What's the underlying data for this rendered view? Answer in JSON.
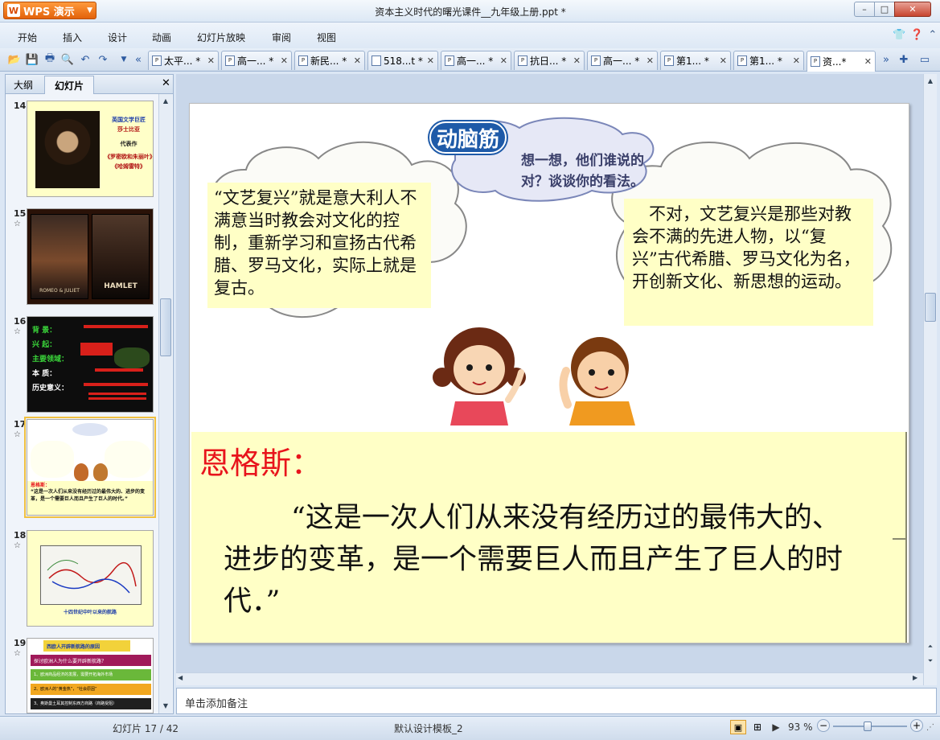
{
  "window": {
    "app_name": "WPS 演示",
    "title": "资本主义时代的曙光课件__九年级上册.ppt *",
    "min_label": "–",
    "max_label": "□",
    "close_label": "✕"
  },
  "menu": [
    "开始",
    "插入",
    "设计",
    "动画",
    "幻灯片放映",
    "审阅",
    "视图"
  ],
  "tabs": [
    {
      "label": "太平... *",
      "close": "✕"
    },
    {
      "label": "高一... *",
      "close": "✕"
    },
    {
      "label": "新民... *",
      "close": "✕"
    },
    {
      "label": "518...t *",
      "close": "✕"
    },
    {
      "label": "高一... *",
      "close": "✕"
    },
    {
      "label": "抗日... *",
      "close": "✕"
    },
    {
      "label": "高一... *",
      "close": "✕"
    },
    {
      "label": "第1... *",
      "close": "✕"
    },
    {
      "label": "第1... *",
      "close": "✕"
    },
    {
      "label": "资...*",
      "close": "✕"
    }
  ],
  "panel": {
    "tab_outline": "大纲",
    "tab_slides": "幻灯片",
    "close": "✕",
    "thumbnails": [
      {
        "num": "14",
        "star": "",
        "lines": [
          "英国文学巨匠",
          "莎士比亚",
          "代表作",
          "《罗密欧和朱丽叶》",
          "《哈姆雷特》"
        ]
      },
      {
        "num": "15",
        "star": "☆",
        "lines": [
          "ROMEO & JULIET",
          "HAMLET"
        ]
      },
      {
        "num": "16",
        "star": "☆",
        "lines": [
          "背 景：",
          "兴 起：",
          "主要领域：",
          "本 质：",
          "历史意义："
        ]
      },
      {
        "num": "17",
        "star": "☆",
        "lines": [
          "恩格斯：",
          "“这是一次人们从来没有经历过的最伟大的、进步的变革，是一个需要巨人而且产生了巨人的时代。”"
        ]
      },
      {
        "num": "18",
        "star": "☆",
        "lines": [
          "十四世纪中叶以来的航路"
        ]
      },
      {
        "num": "19",
        "star": "☆",
        "lines": [
          "西欧人开辟新航路的原因",
          "探讨欧洲人为什么要开辟新航路？",
          "1、欧洲商品经济的发展，需要开拓海外市场",
          "2、欧洲人的“黄金热”，“社会原因”",
          "3、奥斯曼土耳其控制东西方商路（商路受阻）"
        ]
      }
    ]
  },
  "slide": {
    "banner": "动脑筋",
    "prompt": "想一想，他们谁说的对？谈谈你的看法。",
    "left_opinion": "“文艺复兴”就是意大利人不满意当时教会对文化的控制，重新学习和宣扬古代希腊、罗马文化，实际上就是复古。",
    "right_opinion": "不对，文艺复兴是那些对教会不满的先进人物，以“复兴”古代希腊、罗马文化为名，开创新文化、新思想的运动。",
    "quote_author": "恩格斯：",
    "quote_text": "“这是一次人们从来没有经历过的最伟大的、进步的变革，是一个需要巨人而且产生了巨人的时代．”",
    "colors": {
      "author": "#e8141c",
      "box_fill": "#ffffc6",
      "banner": "#1e5aa8"
    }
  },
  "notes_placeholder": "单击添加备注",
  "status": {
    "slide_counter": "幻灯片 17 / 42",
    "template": "默认设计模板_2",
    "zoom": "93 %",
    "zoom_minus": "−",
    "zoom_plus": "+",
    "zoom_level": 0.93
  }
}
